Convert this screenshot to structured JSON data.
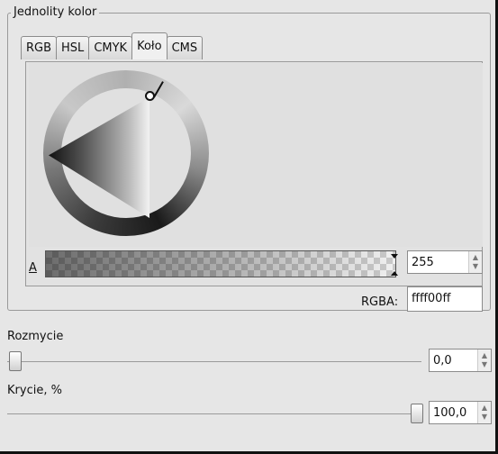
{
  "group_title": "Jednolity kolor",
  "tabs": [
    {
      "label": "RGB",
      "active": false
    },
    {
      "label": "HSL",
      "active": false
    },
    {
      "label": "CMYK",
      "active": false
    },
    {
      "label": "Koło",
      "active": true
    },
    {
      "label": "CMS",
      "active": false
    }
  ],
  "alpha": {
    "label": "A",
    "value": "255"
  },
  "rgba": {
    "label": "RGBA:",
    "value": "ffff00ff"
  },
  "blur": {
    "label": "Rozmycie",
    "value": "0,0",
    "fraction": 0.0
  },
  "opacity": {
    "label": "Krycie, %",
    "value": "100,0",
    "fraction": 1.0
  }
}
